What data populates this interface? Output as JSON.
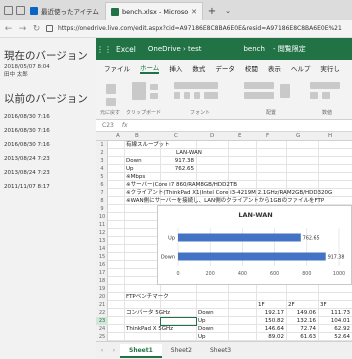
{
  "browser": {
    "tabs": [
      {
        "label": "最近使ったアイテム - OneDriv",
        "active": false
      },
      {
        "label": "bench.xlsx - Microsoft E",
        "active": true
      }
    ],
    "new_tab": "+",
    "tab_menu": "⌄",
    "url": "https://onedrive.live.com/edit.aspx?cid=A97186E8C8BA6E0E&resid=A97186E8C8BA6E0E%21"
  },
  "sidebar": {
    "current_heading": "現在のバージョン",
    "current_date": "2018/05/07 8:04",
    "current_user": "田中 太郎",
    "previous_heading": "以前のバージョン",
    "previous_versions": [
      "2016/08/30 7:16",
      "2016/08/30 7:16",
      "2016/08/30 7:16",
      "2013/08/24 7:23",
      "2013/08/24 7:23",
      "2011/11/07 8:17"
    ]
  },
  "excel": {
    "app_name": "Excel",
    "breadcrumb": "OneDrive › test",
    "file_name": "bench",
    "mode": "- 閲覧限定",
    "ribbon_tabs": [
      "ファイル",
      "ホーム",
      "挿入",
      "数式",
      "データ",
      "校閲",
      "表示",
      "ヘルプ",
      "実行し"
    ],
    "active_ribbon_tab": "ホーム",
    "ribbon_groups": [
      "元に戻す",
      "クリップボード",
      "フォント",
      "配置",
      "数値"
    ],
    "formula_bar": {
      "cell_ref": "C23",
      "fx": "fx"
    },
    "columns": [
      "A",
      "B",
      "C",
      "D",
      "E",
      "F",
      "G",
      "H"
    ],
    "rows": [
      "1",
      "2",
      "3",
      "4",
      "5",
      "6",
      "7",
      "8",
      "9",
      "10",
      "11",
      "12",
      "13",
      "14",
      "15",
      "16",
      "17",
      "18",
      "19",
      "20",
      "21",
      "22",
      "23",
      "24",
      "25"
    ],
    "selected_row": "23",
    "cells": {
      "r1_b": "有線スループット",
      "r2_c": "LAN-WAN",
      "r3_b": "Down",
      "r3_c": "917.38",
      "r4_b": "Up",
      "r4_c": "762.65",
      "r5_b": "※Mbps",
      "r6_b": "※サーバー(Core i7 860/RAM8GB/HDD2TB",
      "r7_b": "※クライアント(ThinkPad X1(Intel Core i3-4219M 2.1GHz/RAM2GB/HDD320G",
      "r8_b": "※WAN側にサーバーを接続し、LAN側のクライアントから1GBのファイルをFTP",
      "r20_b": "FTPベンチマーク",
      "r21_f": "1F",
      "r21_g": "2F",
      "r21_h": "3F",
      "r22_b": "コンバータ 5GHz",
      "r22_e": "Down",
      "r22_f": "192.17",
      "r22_g": "149.06",
      "r22_h": "111.73",
      "r23_e": "Up",
      "r23_f": "150.82",
      "r23_g": "132.16",
      "r23_h": "104.01",
      "r24_b": "ThinkPad X 5GHz",
      "r24_e": "Down",
      "r24_f": "146.64",
      "r24_g": "72.74",
      "r24_h": "62.92",
      "r25_e": "Up",
      "r25_f": "89.02",
      "r25_g": "61.63",
      "r25_h": "52.64"
    },
    "sheet_tabs": [
      "Sheet1",
      "Sheet2",
      "Sheet3"
    ],
    "active_sheet": "Sheet1",
    "accent_color": "#217346"
  },
  "chart_data": {
    "type": "bar",
    "orientation": "horizontal",
    "title": "LAN-WAN",
    "categories": [
      "Up",
      "Down"
    ],
    "values": [
      762.65,
      917.38
    ],
    "xlim": [
      0,
      1000
    ],
    "x_ticks": [
      "0",
      "200",
      "400",
      "600",
      "800",
      "1000"
    ],
    "data_labels": [
      "762.65",
      "917.38"
    ],
    "bar_color": "#4472c4"
  }
}
